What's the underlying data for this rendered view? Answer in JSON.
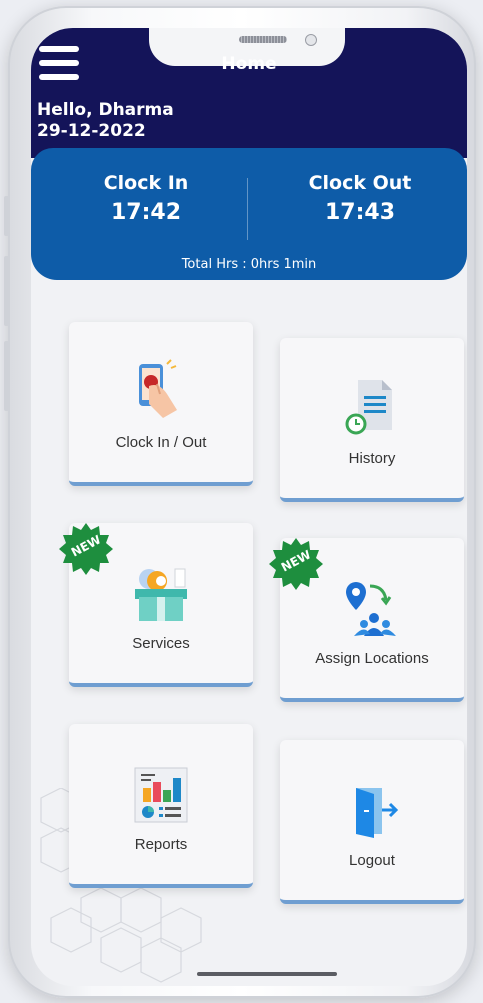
{
  "header": {
    "title": "Home",
    "greeting": "Hello, Dharma",
    "date": "29-12-2022"
  },
  "clock": {
    "in_label": "Clock In",
    "in_time": "17:42",
    "out_label": "Clock Out",
    "out_time": "17:43",
    "total": "Total Hrs : 0hrs 1min"
  },
  "tiles": [
    {
      "label": "Clock In / Out",
      "icon": "clock-in-out-icon",
      "badge": ""
    },
    {
      "label": "History",
      "icon": "history-icon",
      "badge": ""
    },
    {
      "label": "Services",
      "icon": "services-icon",
      "badge": "NEW"
    },
    {
      "label": "Assign Locations",
      "icon": "assign-locations-icon",
      "badge": "NEW"
    },
    {
      "label": "Reports",
      "icon": "reports-icon",
      "badge": ""
    },
    {
      "label": "Logout",
      "icon": "logout-icon",
      "badge": ""
    }
  ],
  "colors": {
    "header_dark": "#141459",
    "header_blue": "#0e5ca8",
    "card_accent": "#6f9ed1",
    "badge_green": "#1e8e3e"
  }
}
